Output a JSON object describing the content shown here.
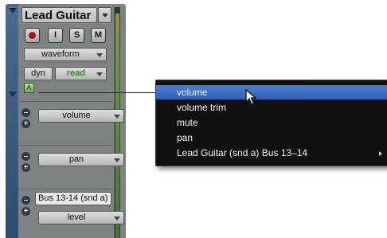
{
  "track": {
    "name": "Lead Guitar",
    "buttons": {
      "record_icon": "record-dot-icon",
      "input": "I",
      "solo": "S",
      "mute": "M"
    },
    "view_select": "waveform",
    "automation": {
      "label": "dyn",
      "mode": "read",
      "mode_color": "#2e8a22"
    },
    "lanes": [
      {
        "parameter": "volume"
      },
      {
        "parameter": "pan"
      },
      {
        "name": "Bus 13-14 (snd a)",
        "parameter": "level"
      }
    ]
  },
  "popup_menu": {
    "items": [
      {
        "label": "volume",
        "highlighted": true
      },
      {
        "label": "volume trim"
      },
      {
        "label": "mute"
      },
      {
        "label": "pan"
      },
      {
        "label": "Lead Guitar  (snd a) Bus 13–14",
        "has_submenu": true
      }
    ]
  },
  "colors": {
    "sidebar": "#3c5a7d",
    "menu_bg": "#101010",
    "menu_highlight": "#3d6ec4"
  }
}
